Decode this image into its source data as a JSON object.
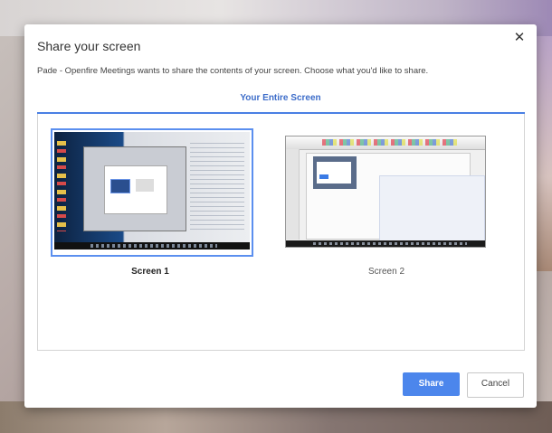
{
  "dialog": {
    "title": "Share your screen",
    "description": "Pade - Openfire Meetings wants to share the contents of your screen. Choose what you'd like to share.",
    "close_glyph": "✕",
    "tab_label": "Your Entire Screen",
    "screens": [
      {
        "label": "Screen 1",
        "selected": true
      },
      {
        "label": "Screen 2",
        "selected": false
      }
    ],
    "buttons": {
      "share_label": "Share",
      "cancel_label": "Cancel"
    }
  },
  "colors": {
    "accent": "#4c86ec",
    "tab_text": "#3c6cc9"
  }
}
